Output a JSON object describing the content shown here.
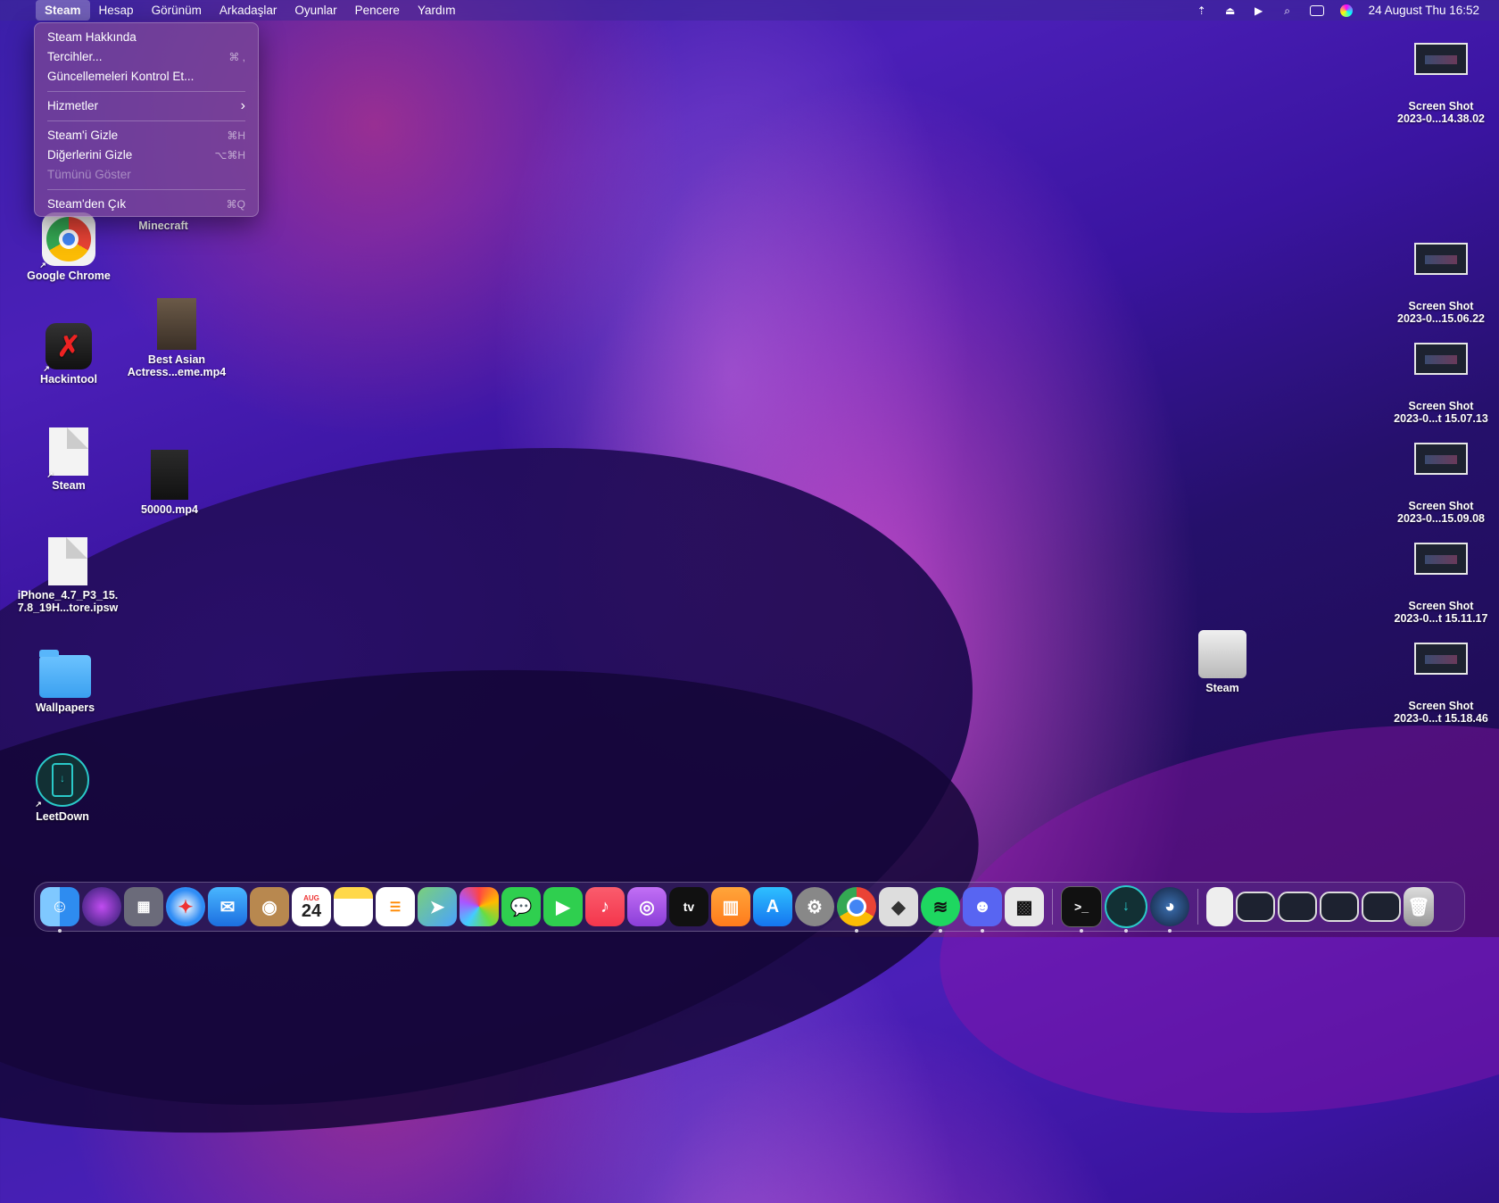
{
  "menubar": {
    "app_name": "Steam",
    "menus": [
      "Hesap",
      "Görünüm",
      "Arkadaşlar",
      "Oyunlar",
      "Pencere",
      "Yardım"
    ],
    "clock": "24 August Thu  16:52"
  },
  "dropdown": {
    "items": [
      {
        "label": "Steam Hakkında",
        "shortcut": ""
      },
      {
        "label": "Tercihler...",
        "shortcut": "⌘ ,"
      },
      {
        "label": "Güncellemeleri Kontrol Et...",
        "shortcut": ""
      },
      {
        "label": "Hizmetler",
        "shortcut": "›"
      },
      {
        "label": "Steam'i Gizle",
        "shortcut": "⌘H"
      },
      {
        "label": "Diğerlerini Gizle",
        "shortcut": "⌥⌘H"
      },
      {
        "label": "Tümünü Göster",
        "shortcut": ""
      },
      {
        "label": "Steam'den Çık",
        "shortcut": "⌘Q"
      }
    ]
  },
  "desktop": {
    "left_icons": {
      "minecraft": "Minecraft",
      "chrome": "Google Chrome",
      "hackintool": "Hackintool",
      "video1_line1": "Best Asian",
      "video1_line2": "Actress...eme.mp4",
      "steam_doc": "Steam",
      "video2": "50000.mp4",
      "ipsw_line1": "iPhone_4.7_P3_15.",
      "ipsw_line2": "7.8_19H...tore.ipsw",
      "wallpapers": "Wallpapers",
      "leetdown": "LeetDown"
    },
    "disk": "Steam",
    "screenshots": [
      {
        "line1": "Screen Shot",
        "line2": "2023-0...14.38.02"
      },
      {
        "line1": "Screen Shot",
        "line2": "2023-0...15.06.22"
      },
      {
        "line1": "Screen Shot",
        "line2": "2023-0...t 15.07.13"
      },
      {
        "line1": "Screen Shot",
        "line2": "2023-0...15.09.08"
      },
      {
        "line1": "Screen Shot",
        "line2": "2023-0...t 15.11.17"
      },
      {
        "line1": "Screen Shot",
        "line2": "2023-0...t 15.18.46"
      }
    ]
  },
  "dock": {
    "calendar_month": "AUG",
    "calendar_day": "24",
    "tv_label": "tv"
  }
}
